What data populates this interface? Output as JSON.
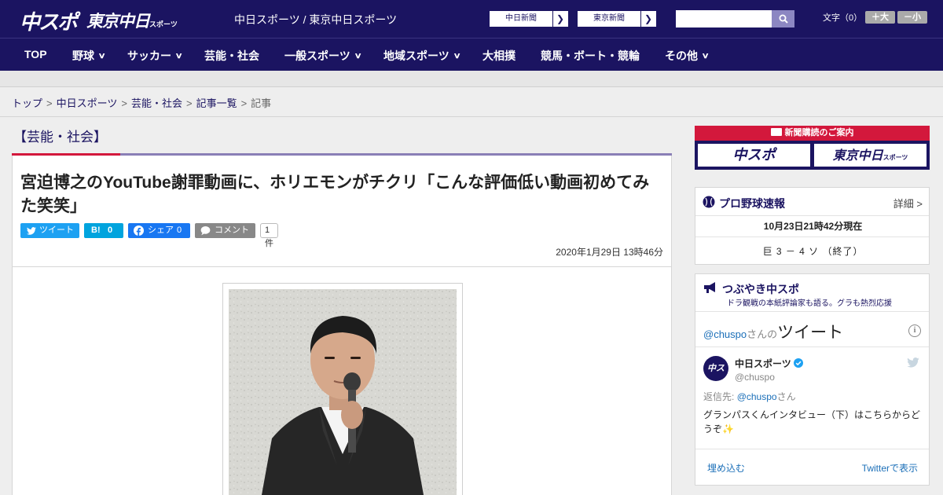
{
  "header": {
    "logo_main": "中スポ",
    "logo_tokyo": "東京中日",
    "logo_tokyo_small": "スポーツ",
    "site_title": "中日スポーツ / 東京中日スポーツ",
    "btn_chunichi": "中日新聞",
    "btn_tokyo": "東京新聞",
    "search_placeholder": "",
    "font_label": "文字（0）",
    "font_larger": "＋大",
    "font_smaller": "－小"
  },
  "nav": [
    {
      "label": "TOP",
      "has_menu": false
    },
    {
      "label": "野球",
      "has_menu": true
    },
    {
      "label": "サッカー",
      "has_menu": true
    },
    {
      "label": "芸能・社会",
      "has_menu": false
    },
    {
      "label": "一般スポーツ",
      "has_menu": true
    },
    {
      "label": "地域スポーツ",
      "has_menu": true
    },
    {
      "label": "大相撲",
      "has_menu": false
    },
    {
      "label": "競馬・ボート・競輪",
      "has_menu": false
    },
    {
      "label": "その他",
      "has_menu": true
    }
  ],
  "breadcrumb": {
    "items": [
      "トップ",
      "中日スポーツ",
      "芸能・社会",
      "記事一覧"
    ],
    "current": "記事",
    "separator": ">"
  },
  "article": {
    "section": "【芸能・社会】",
    "headline": "宮迫博之のYouTube謝罪動画に、ホリエモンがチクリ「こんな評価低い動画初めてみた笑笑」",
    "tweet_label": "ツイート",
    "hatena_label": "B!",
    "hatena_count": "0",
    "share_label": "シェア",
    "share_count": "0",
    "comment_label": "コメント",
    "comment_count": "1件",
    "date": "2020年1月29日 13時46分"
  },
  "sidebar": {
    "subscribe_head": "新聞購読のご案内",
    "subscribe_logo1": "中スポ",
    "subscribe_logo2": "東京中日",
    "subscribe_logo2_small": "スポーツ",
    "baseball_title": "プロ野球速報",
    "baseball_detail": "詳細 >",
    "baseball_date": "10月23日21時42分現在",
    "baseball_score": "巨 3 － 4 ソ （終了）",
    "twitter_title": "つぶやき中スポ",
    "twitter_sub": "ドラ観戦の本紙評論家も語る。グラも熱烈応援",
    "timeline_handle": "@chuspo",
    "timeline_san": "さんの",
    "timeline_tweet": "ツイート",
    "tweet_name": "中日スポーツ",
    "tweet_handle": "@chuspo",
    "reply_prefix": "返信先:",
    "reply_handle": "@chuspo",
    "reply_suffix": "さん",
    "tweet_text": "グランパスくんインタビュー（下）はこちらからどうぞ✨",
    "embed_label": "埋め込む",
    "view_label": "Twitterで表示"
  },
  "colors": {
    "brand_navy": "#1b1461",
    "accent_red": "#d3183c",
    "twitter_blue": "#1da1f2",
    "hatena_blue": "#00a4de",
    "facebook_blue": "#1877f2",
    "comment_gray": "#888888"
  }
}
